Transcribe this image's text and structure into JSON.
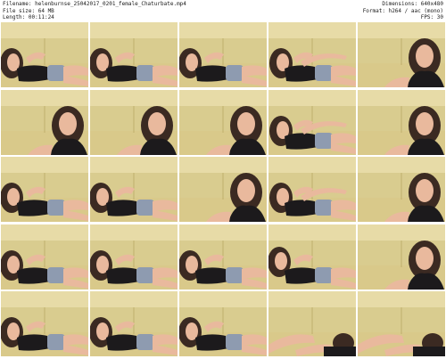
{
  "header": {
    "filename": "Filename: helenburnse_25042017_0201_female_Chaturbate.mp4",
    "filesize": "File size: 64 MB",
    "length": "Length: 00:11:24",
    "dimensions": "Dimensions: 640x480",
    "format": "Format: h264 / aac (mono)",
    "fps": "FPS: 30"
  },
  "thumbnails": {
    "rows": 5,
    "cols": 5,
    "poses": [
      "a",
      "a",
      "a",
      "b",
      "c",
      "c",
      "c",
      "c",
      "b",
      "c",
      "a",
      "a",
      "c",
      "b",
      "c",
      "a",
      "a",
      "a",
      "d",
      "c",
      "a",
      "a",
      "a",
      "e",
      "e"
    ]
  },
  "colors": {
    "wall": "#e7dba7",
    "couch": "#cdbf7c",
    "skin": "#e9b99d",
    "hair": "#3b2a22",
    "top": "#1c1a1c",
    "shorts": "#8e9bb0"
  }
}
